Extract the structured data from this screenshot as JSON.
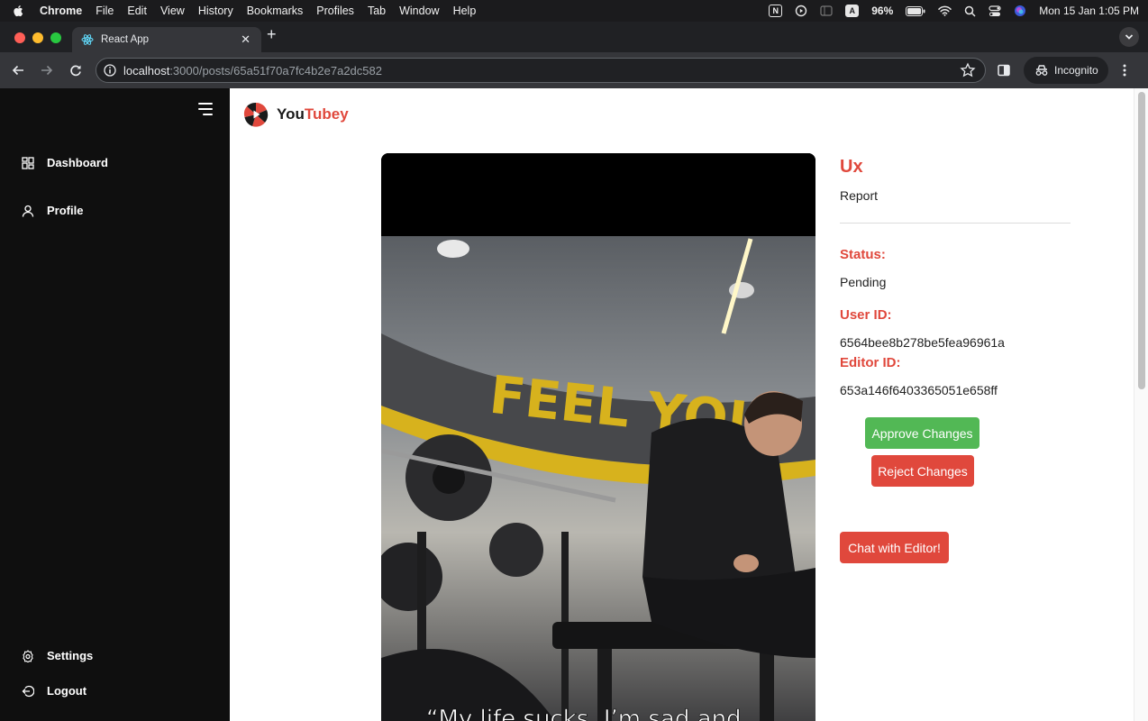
{
  "menubar": {
    "app_name": "Chrome",
    "menus": [
      "File",
      "Edit",
      "View",
      "History",
      "Bookmarks",
      "Profiles",
      "Tab",
      "Window",
      "Help"
    ],
    "battery": "96%",
    "datetime": "Mon 15 Jan 1:05 PM",
    "keyboard_indicator": "A",
    "notion_indicator": "N"
  },
  "browser": {
    "tab_title": "React App",
    "url_host": "localhost",
    "url_path": ":3000/posts/65a51f70a7fc4b2e7a2dc582",
    "incognito_label": "Incognito"
  },
  "sidebar": {
    "items": [
      {
        "label": "Dashboard",
        "icon": "dashboard-grid-icon"
      },
      {
        "label": "Profile",
        "icon": "user-icon"
      }
    ],
    "bottom_items": [
      {
        "label": "Settings",
        "icon": "gear-icon"
      },
      {
        "label": "Logout",
        "icon": "logout-icon"
      }
    ]
  },
  "logo": {
    "text_main": "You",
    "text_accent": "Tubey"
  },
  "video": {
    "wall_text": "FEEL YOU",
    "caption": "“My life sucks, I’m sad and"
  },
  "post": {
    "title": "Ux",
    "description": "Report",
    "status_label": "Status:",
    "status_value": "Pending",
    "user_id_label": "User ID:",
    "user_id_value": "6564bee8b278be5fea96961a",
    "editor_id_label": "Editor ID:",
    "editor_id_value": "653a146f6403365051e658ff"
  },
  "actions": {
    "approve_label": "Approve Changes",
    "reject_label": "Reject Changes",
    "chat_label": "Chat with Editor!"
  },
  "colors": {
    "accent_red": "#e0483c",
    "approve_green": "#52b855",
    "sidebar_bg": "#0f0f0f"
  }
}
